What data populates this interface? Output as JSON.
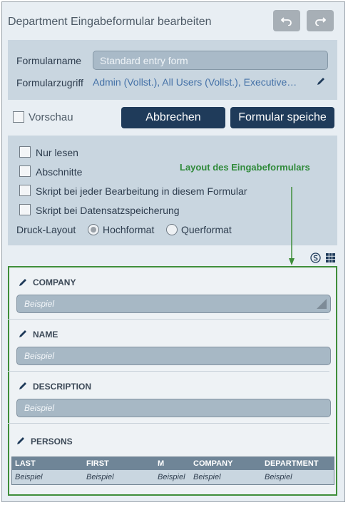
{
  "window": {
    "title": "Department Eingabeformular bearbeiten",
    "undo_icon": "undo-icon",
    "redo_icon": "redo-icon"
  },
  "form_settings": {
    "name_label": "Formularname",
    "name_value": "Standard entry form",
    "access_label": "Formularzugriff",
    "access_value": "Admin (Vollst.), All Users (Vollst.), Executive…",
    "edit_icon": "pencil-icon"
  },
  "toolbar": {
    "preview_label": "Vorschau",
    "preview_checked": false,
    "cancel_label": "Abbrechen",
    "save_label": "Formular speiche"
  },
  "options": {
    "read_only": "Nur lesen",
    "sections": "Abschnitte",
    "script_each_edit": "Skript bei jeder Bearbeitung in diesem Formular",
    "script_on_save": "Skript bei Datensatzspeicherung",
    "print_layout_label": "Druck-Layout",
    "portrait": "Hochformat",
    "landscape": "Querformat",
    "selected_orientation": "Hochformat"
  },
  "annotation": {
    "text": "Layout des Eingabeformulars"
  },
  "layout_tools": {
    "icons": [
      "s-circle-icon",
      "grid-icon"
    ]
  },
  "form_fields": [
    {
      "label": "COMPANY",
      "placeholder": "Beispiel",
      "type": "combo"
    },
    {
      "label": "NAME",
      "placeholder": "Beispiel",
      "type": "text"
    },
    {
      "label": "DESCRIPTION",
      "placeholder": "Beispiel",
      "type": "text"
    }
  ],
  "persons": {
    "label": "PERSONS",
    "columns": [
      "LAST",
      "FIRST",
      "M",
      "COMPANY",
      "DEPARTMENT"
    ],
    "row": [
      "Beispiel",
      "Beispiel",
      "Beispiel",
      "Beispiel",
      "Beispiel"
    ]
  },
  "colors": {
    "button_dark": "#1f3b5a",
    "panel": "#c9d6e0",
    "annotation_green": "#2f8a3a",
    "link_blue": "#4471a7"
  }
}
